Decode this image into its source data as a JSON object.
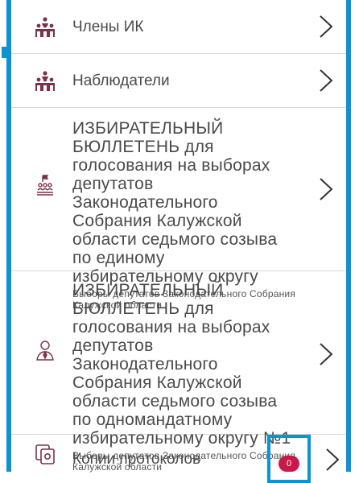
{
  "items": [
    {
      "label": "Члены ИК",
      "icon": "group-icon"
    },
    {
      "label": "Наблюдатели",
      "icon": "observers-icon"
    },
    {
      "label": "ИЗБИРАТЕЛЬНЫЙ БЮЛЛЕТЕНЬ для голосования на выборах депутатов Законодательного Собрания Калужской области седьмого созыва по единому избирательному округу",
      "subtitle": "Выборы депутатов Законодательного Собрания Калужской области",
      "icon": "party-list-icon"
    },
    {
      "label": "ИЗБИРАТЕЛЬНЫЙ БЮЛЛЕТЕНЬ для голосования на выборах депутатов Законодательного Собрания Калужской области седьмого созыва по одномандатному избирательному округу №1",
      "subtitle": "Выборы депутатов Законодательного Собрания Калужской области",
      "icon": "candidate-icon"
    },
    {
      "label": "Копии протоколов",
      "badge": "0",
      "icon": "copies-icon"
    }
  ],
  "colors": {
    "accent": "#0c93d2",
    "badge": "#c8194a",
    "icon": "#7a3347"
  }
}
